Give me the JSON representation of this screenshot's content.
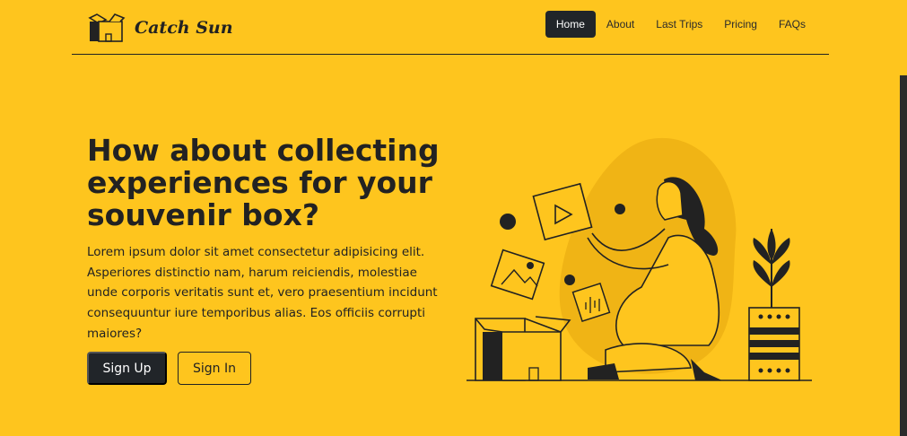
{
  "brand": {
    "name": "Catch Sun"
  },
  "nav": {
    "items": [
      {
        "label": "Home",
        "active": true
      },
      {
        "label": "About"
      },
      {
        "label": "Last Trips"
      },
      {
        "label": "Pricing"
      },
      {
        "label": "FAQs"
      }
    ]
  },
  "hero": {
    "title": "How about collecting experiences for your souvenir box?",
    "text": "Lorem ipsum dolor sit amet consectetur adipisicing elit. Asperiores distinctio nam, harum reiciendis, molestiae unde corporis veritatis sunt et, vero praesentium incidunt consequuntur iure temporibus alias. Eos officiis corrupti maiores?",
    "signup_label": "Sign Up",
    "signin_label": "Sign In"
  },
  "colors": {
    "background": "#FEC51E",
    "dark": "#212529"
  },
  "icons": {
    "logo": "box-icon",
    "illustration": "woman-with-souvenir-box-illustration"
  }
}
